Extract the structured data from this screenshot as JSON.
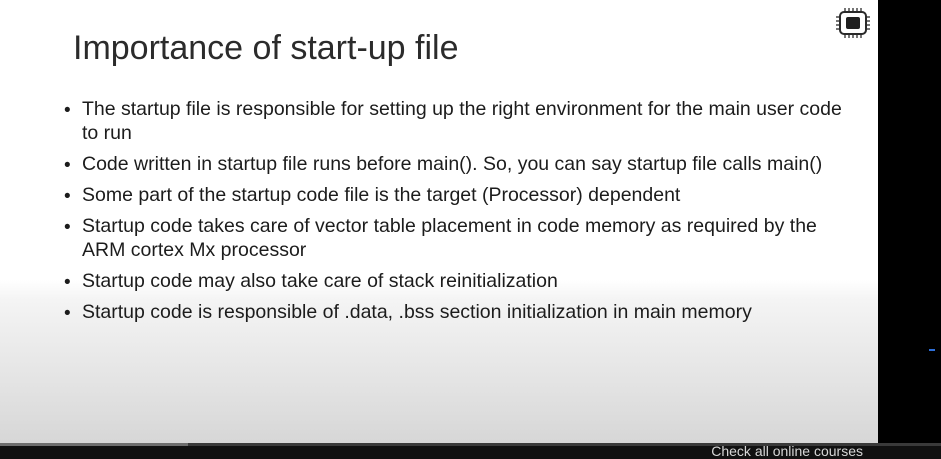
{
  "slide": {
    "title": "Importance of start-up file",
    "bullets": [
      "The startup file is responsible for setting up the right environment for the main user code to run",
      "Code written in startup file runs before main(). So, you can say startup file calls main()",
      "Some part of the startup code file is the target (Processor) dependent",
      "Startup code takes care of vector table placement in code memory as required by the ARM cortex Mx processor",
      "Startup code may also take care of stack reinitialization",
      "Startup code is responsible of .data, .bss section initialization in main memory"
    ],
    "bullet_symbol": "•",
    "badge_icon": "microchip-icon"
  },
  "player": {
    "courses_link": "Check all online courses",
    "progress_fraction": 0.2
  },
  "colors": {
    "slide_background": "#ffffff",
    "text": "#1c1c1c",
    "title": "#2b2b2b",
    "player_background": "#000000",
    "marker": "#2e6fd8"
  }
}
